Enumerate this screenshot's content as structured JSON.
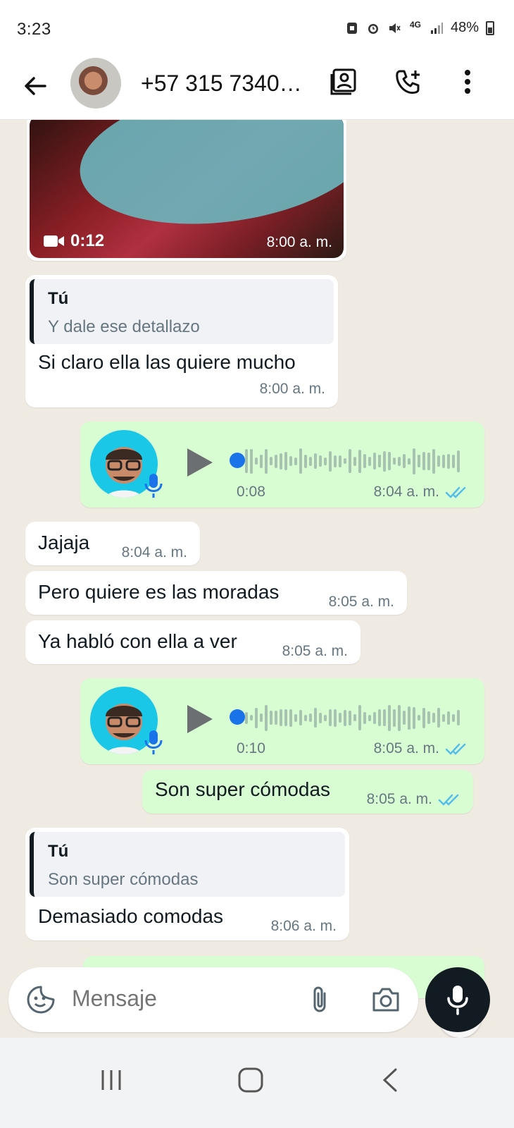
{
  "status": {
    "time": "3:23",
    "network": "4G",
    "battery": "48%",
    "icons": [
      "sim-icon",
      "alarm-icon",
      "mute-icon",
      "network-4g-icon",
      "signal-icon",
      "battery-icon"
    ]
  },
  "header": {
    "contact": "+57 315 7340…",
    "icons": [
      "back-arrow-icon",
      "contact-avatar",
      "contact-card-icon",
      "add-call-icon",
      "more-options-icon"
    ]
  },
  "messages": [
    {
      "type": "video",
      "direction": "in",
      "duration": "0:12",
      "time": "8:00 a. m."
    },
    {
      "type": "reply",
      "direction": "in",
      "quote_author": "Tú",
      "quote_text": "Y dale ese detallazo",
      "text": "Si claro ella las quiere mucho",
      "time": "8:00 a. m."
    },
    {
      "type": "voice",
      "direction": "out",
      "duration": "0:08",
      "time": "8:04 a. m.",
      "read": true
    },
    {
      "type": "text",
      "direction": "in",
      "text": "Jajaja",
      "time": "8:04 a. m."
    },
    {
      "type": "text",
      "direction": "in",
      "text": "Pero quiere es las moradas",
      "time": "8:05 a. m."
    },
    {
      "type": "text",
      "direction": "in",
      "text": "Ya habló con ella a ver",
      "time": "8:05 a. m."
    },
    {
      "type": "voice",
      "direction": "out",
      "duration": "0:10",
      "time": "8:05 a. m.",
      "read": true
    },
    {
      "type": "text",
      "direction": "out",
      "text": "Son super cómodas",
      "time": "8:05 a. m.",
      "read": true
    },
    {
      "type": "reply",
      "direction": "in",
      "quote_author": "Tú",
      "quote_text": "Son super cómodas",
      "text": "Demasiado comodas",
      "time": "8:06 a. m."
    }
  ],
  "composer": {
    "placeholder": "Mensaje",
    "icons": [
      "sticker-icon",
      "attach-icon",
      "camera-icon",
      "mic-icon"
    ]
  },
  "colors": {
    "incoming_bubble": "#ffffff",
    "outgoing_bubble": "#d9fdd3",
    "read_ticks": "#53bdeb",
    "chat_bg": "#efeae2",
    "voice_avatar_bg": "#1ac7e6",
    "play_dot": "#1a73e8"
  }
}
